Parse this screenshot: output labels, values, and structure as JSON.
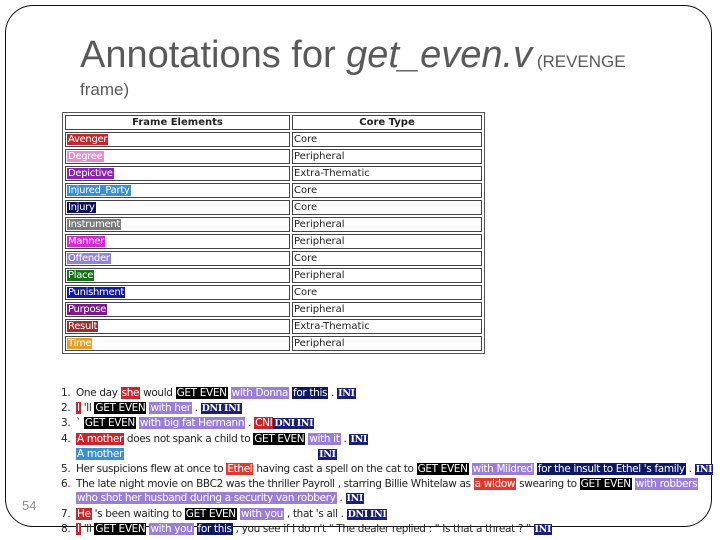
{
  "slide": {
    "title_main": "Annotations for ",
    "title_italic": "get_even.v",
    "title_small": " (REVENGE",
    "subtitle": "frame)",
    "page_number": "54"
  },
  "table": {
    "headers": [
      "Frame Elements",
      "Core Type"
    ],
    "rows": [
      {
        "fe": "Avenger",
        "type": "Core",
        "color": "#c0282d"
      },
      {
        "fe": "Degree",
        "type": "Peripheral",
        "color": "#e58fd0"
      },
      {
        "fe": "Depictive",
        "type": "Extra-Thematic",
        "color": "#8b22b4"
      },
      {
        "fe": "Injured_Party",
        "type": "Core",
        "color": "#3a8fd1"
      },
      {
        "fe": "Injury",
        "type": "Core",
        "color": "#0d0f55"
      },
      {
        "fe": "Instrument",
        "type": "Peripheral",
        "color": "#7b7b7b"
      },
      {
        "fe": "Manner",
        "type": "Peripheral",
        "color": "#d22ad6"
      },
      {
        "fe": "Offender",
        "type": "Core",
        "color": "#9583d4"
      },
      {
        "fe": "Place",
        "type": "Peripheral",
        "color": "#177019"
      },
      {
        "fe": "Punishment",
        "type": "Core",
        "color": "#101a9a"
      },
      {
        "fe": "Purpose",
        "type": "Peripheral",
        "color": "#7a1c86"
      },
      {
        "fe": "Result",
        "type": "Extra-Thematic",
        "color": "#963031"
      },
      {
        "fe": "Time",
        "type": "Peripheral",
        "color": "#dea12a"
      }
    ]
  },
  "sentences": [
    {
      "num": "1.",
      "lines": [
        [
          {
            "t": "One day "
          },
          {
            "t": "she",
            "c": "avenger"
          },
          {
            "t": " would "
          },
          {
            "t": "GET EVEN",
            "c": "target"
          },
          {
            "t": " "
          },
          {
            "t": "with Donna",
            "c": "offender"
          },
          {
            "t": " "
          },
          {
            "t": "for this",
            "c": "punish"
          },
          {
            "t": " . "
          },
          {
            "t": "INI",
            "c": "ini"
          }
        ]
      ]
    },
    {
      "num": "2.",
      "lines": [
        [
          {
            "t": "I",
            "c": "avenger"
          },
          {
            "t": " 'll "
          },
          {
            "t": "GET EVEN",
            "c": "target"
          },
          {
            "t": " "
          },
          {
            "t": "with her",
            "c": "offender"
          },
          {
            "t": " . "
          },
          {
            "t": "DNI",
            "c": "ini"
          },
          {
            "t": "INI",
            "c": "ini"
          }
        ]
      ]
    },
    {
      "num": "3.",
      "lines": [
        [
          {
            "t": "` "
          },
          {
            "t": "GET EVEN",
            "c": "target"
          },
          {
            "t": " "
          },
          {
            "t": "with big fat Hermann",
            "c": "offender"
          },
          {
            "t": " . "
          },
          {
            "t": "CNI",
            "c": "avenger"
          },
          {
            "t": "DNI",
            "c": "ini"
          },
          {
            "t": "INI",
            "c": "ini"
          }
        ]
      ]
    },
    {
      "num": "4.",
      "lines": [
        [
          {
            "t": "A mother",
            "c": "avenger"
          },
          {
            "t": " does not spank a child to "
          },
          {
            "t": "GET EVEN",
            "c": "target"
          },
          {
            "t": " "
          },
          {
            "t": "with it",
            "c": "offender"
          },
          {
            "t": " . "
          },
          {
            "t": "INI",
            "c": "ini"
          }
        ],
        [
          {
            "t": "A mother",
            "c": "injured"
          },
          {
            "t": "                                                                 "
          },
          {
            "t": "INI",
            "c": "ini"
          }
        ]
      ]
    },
    {
      "num": "5.",
      "lines": [
        [
          {
            "t": "Her suspicions flew at once to "
          },
          {
            "t": "Ethel",
            "c": "avenger2"
          },
          {
            "t": " having cast a spell on the cat to "
          },
          {
            "t": "GET EVEN",
            "c": "target"
          },
          {
            "t": " "
          },
          {
            "t": "with Mildred",
            "c": "offender"
          },
          {
            "t": " "
          },
          {
            "t": "for the insult to Ethel 's family",
            "c": "punish"
          },
          {
            "t": " . "
          },
          {
            "t": "INI",
            "c": "ini"
          }
        ]
      ]
    },
    {
      "num": "6.",
      "lines": [
        [
          {
            "t": "The late night movie on BBC2 was the thriller Payroll , starring Billie Whitelaw as "
          },
          {
            "t": "a widow",
            "c": "avenger2"
          },
          {
            "t": " swearing to "
          },
          {
            "t": "GET EVEN",
            "c": "target"
          },
          {
            "t": " "
          },
          {
            "t": "with robbers",
            "c": "offender"
          }
        ],
        [
          {
            "t": "who shot her husband during a security van robbery",
            "c": "offender"
          },
          {
            "t": " . "
          },
          {
            "t": "INI",
            "c": "ini"
          }
        ]
      ]
    },
    {
      "num": "7.",
      "lines": [
        [
          {
            "t": "He",
            "c": "avenger"
          },
          {
            "t": " 's been waiting to "
          },
          {
            "t": "GET EVEN",
            "c": "target"
          },
          {
            "t": " "
          },
          {
            "t": "with you",
            "c": "offender"
          },
          {
            "t": " , that 's all . "
          },
          {
            "t": "DNI",
            "c": "ini"
          },
          {
            "t": "INI",
            "c": "ini"
          }
        ]
      ]
    },
    {
      "num": "8.",
      "lines": [
        [
          {
            "t": "I",
            "c": "avenger"
          },
          {
            "t": " 'll "
          },
          {
            "t": "GET EVEN",
            "c": "target"
          },
          {
            "t": " "
          },
          {
            "t": "with you",
            "c": "offender"
          },
          {
            "t": " "
          },
          {
            "t": "for this",
            "c": "punish"
          },
          {
            "t": " , you see if I do n't \" The dealer replied : \" Is that a threat ? \" "
          },
          {
            "t": "INI",
            "c": "ini"
          }
        ]
      ]
    }
  ]
}
